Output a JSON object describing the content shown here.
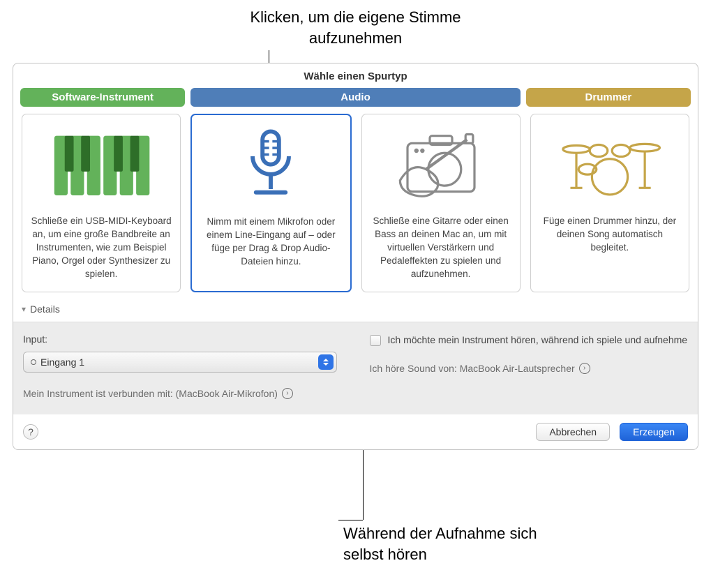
{
  "annotations": {
    "top": "Klicken, um die eigene Stimme aufzunehmen",
    "bottom": "Während der Aufnahme sich selbst hören"
  },
  "dialog": {
    "title": "Wähle einen Spurtyp",
    "tabs": {
      "software_instrument": "Software-Instrument",
      "audio": "Audio",
      "drummer": "Drummer"
    },
    "cards": {
      "software": "Schließe ein USB-MIDI-Keyboard an, um eine große Bandbreite an Instrumenten, wie zum Beispiel Piano, Orgel oder Synthesizer zu spielen.",
      "mic": "Nimm mit einem Mikrofon oder einem Line-Eingang auf – oder füge per Drag & Drop Audio-Dateien hinzu.",
      "guitar": "Schließe eine Gitarre oder einen Bass an deinen Mac an, um mit virtuellen Verstärkern und Pedaleffekten zu spielen und aufzunehmen.",
      "drummer": "Füge einen Drummer hinzu, der deinen Song automatisch begleitet."
    },
    "details_label": "Details",
    "input_label": "Input:",
    "input_value": "Eingang 1",
    "connected_label": "Mein Instrument ist verbunden mit: (MacBook Air-Mikrofon)",
    "monitor_checkbox": "Ich möchte mein Instrument hören, während ich spiele und aufnehme",
    "sound_from": "Ich höre Sound von: MacBook Air-Lautsprecher",
    "buttons": {
      "cancel": "Abbrechen",
      "create": "Erzeugen"
    }
  }
}
